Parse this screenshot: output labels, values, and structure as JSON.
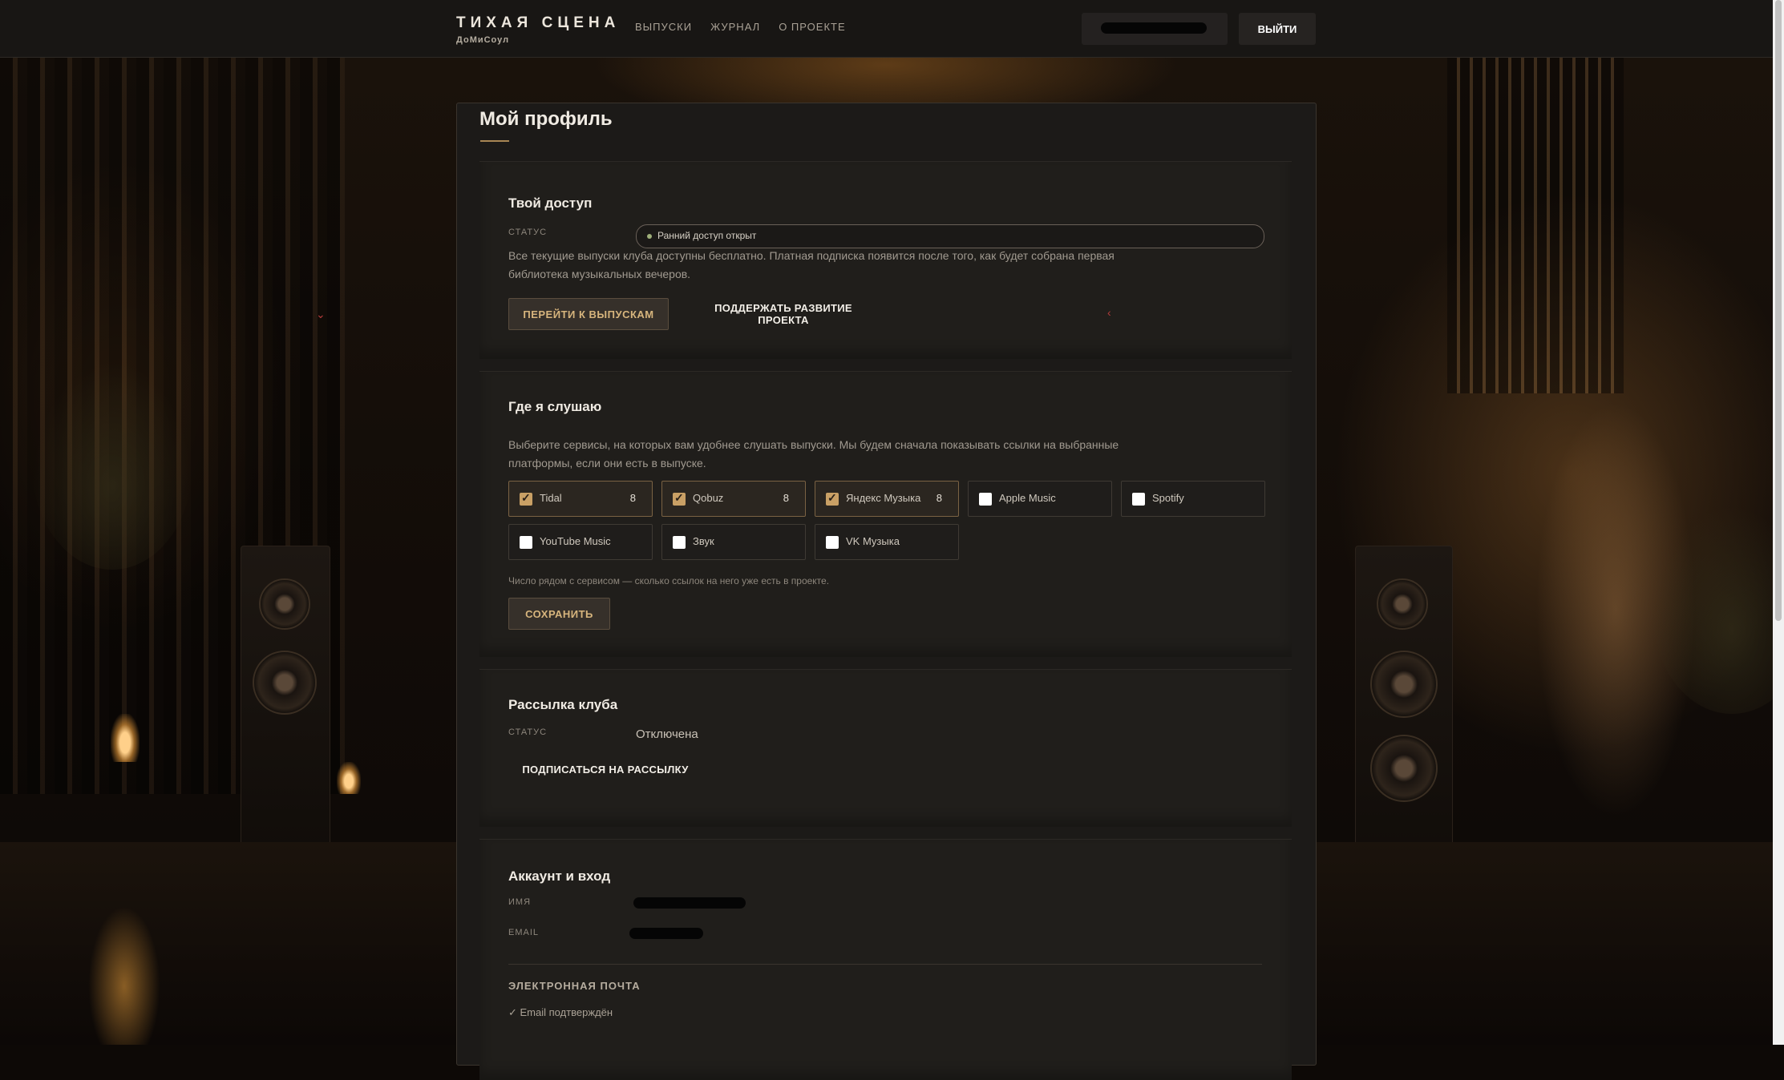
{
  "header": {
    "brand_title": "ТИХАЯ СЦЕНА",
    "brand_sub": "ДоМиСоул",
    "nav": [
      "ВЫПУСКИ",
      "ЖУРНАЛ",
      "О ПРОЕКТЕ"
    ],
    "logout_label": "ВЫЙТИ"
  },
  "page": {
    "title": "Мой профиль"
  },
  "access": {
    "title": "Твой доступ",
    "status_label": "СТАТУС",
    "status_value": "Ранний доступ открыт",
    "description": "Все текущие выпуски клуба доступны бесплатно. Платная подписка появится после того, как будет собрана первая библиотека музыкальных вечеров.",
    "primary_button": "ПЕРЕЙТИ К ВЫПУСКАМ",
    "secondary_button": "ПОДДЕРЖАТЬ РАЗВИТИЕ ПРОЕКТА"
  },
  "listening": {
    "title": "Где я слушаю",
    "description": "Выберите сервисы, на которых вам удобнее слушать выпуски. Мы будем сначала показывать ссылки на выбранные платформы, если они есть в выпуске.",
    "services": [
      {
        "name": "Tidal",
        "checked": true,
        "count": "8"
      },
      {
        "name": "Qobuz",
        "checked": true,
        "count": "8"
      },
      {
        "name": "Яндекс Музыка",
        "checked": true,
        "count": "8"
      },
      {
        "name": "Apple Music",
        "checked": false,
        "count": ""
      },
      {
        "name": "Spotify",
        "checked": false,
        "count": ""
      },
      {
        "name": "YouTube Music",
        "checked": false,
        "count": ""
      },
      {
        "name": "Звук",
        "checked": false,
        "count": ""
      },
      {
        "name": "VK Музыка",
        "checked": false,
        "count": ""
      }
    ],
    "hint": "Число рядом с сервисом — сколько ссылок на него уже есть в проекте.",
    "save_button": "СОХРАНИТЬ"
  },
  "newsletter": {
    "title": "Рассылка клуба",
    "status_label": "СТАТУС",
    "status_value": "Отключена",
    "subscribe_button": "ПОДПИСАТЬСЯ НА РАССЫЛКУ"
  },
  "account": {
    "title": "Аккаунт и вход",
    "name_label": "ИМЯ",
    "email_label": "EMAIL",
    "email_section": "ЭЛЕКТРОННАЯ ПОЧТА",
    "email_verified": "✓ Email подтверждён"
  }
}
